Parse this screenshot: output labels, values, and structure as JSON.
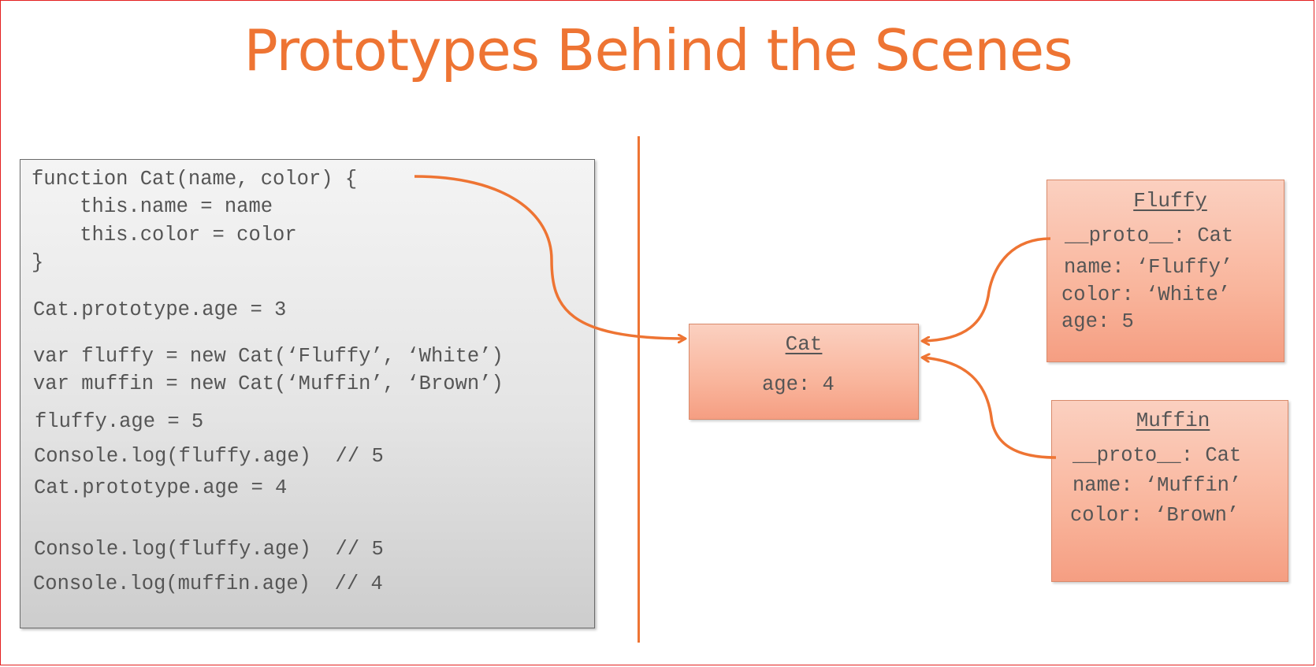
{
  "slide": {
    "title": "Prototypes Behind the Scenes",
    "accent_color": "#ee7433",
    "box_fill_color": "#f9b59c"
  },
  "code": {
    "lines": [
      "function Cat(name, color) {",
      "    this.name = name",
      "    this.color = color",
      "}",
      "Cat.prototype.age = 3",
      "var fluffy = new Cat(‘Fluffy’, ‘White’)",
      "var muffin = new Cat(‘Muffin’, ‘Brown’)",
      "fluffy.age = 5",
      "Console.log(fluffy.age)  // 5",
      "Cat.prototype.age = 4",
      "Console.log(fluffy.age)  // 5",
      "Console.log(muffin.age)  // 4"
    ]
  },
  "objects": {
    "cat": {
      "title": "Cat",
      "props": [
        "age: 4"
      ]
    },
    "fluffy": {
      "title": "Fluffy",
      "props": [
        "__proto__: Cat",
        "name: ‘Fluffy’",
        "color: ‘White’",
        "age: 5"
      ]
    },
    "muffin": {
      "title": "Muffin",
      "props": [
        "__proto__: Cat",
        "name: ‘Muffin’",
        "color: ‘Brown’"
      ]
    }
  },
  "connections": [
    {
      "from": "code.function-declaration",
      "to": "objects.cat"
    },
    {
      "from": "objects.fluffy.__proto__",
      "to": "objects.cat"
    },
    {
      "from": "objects.muffin.__proto__",
      "to": "objects.cat"
    }
  ]
}
